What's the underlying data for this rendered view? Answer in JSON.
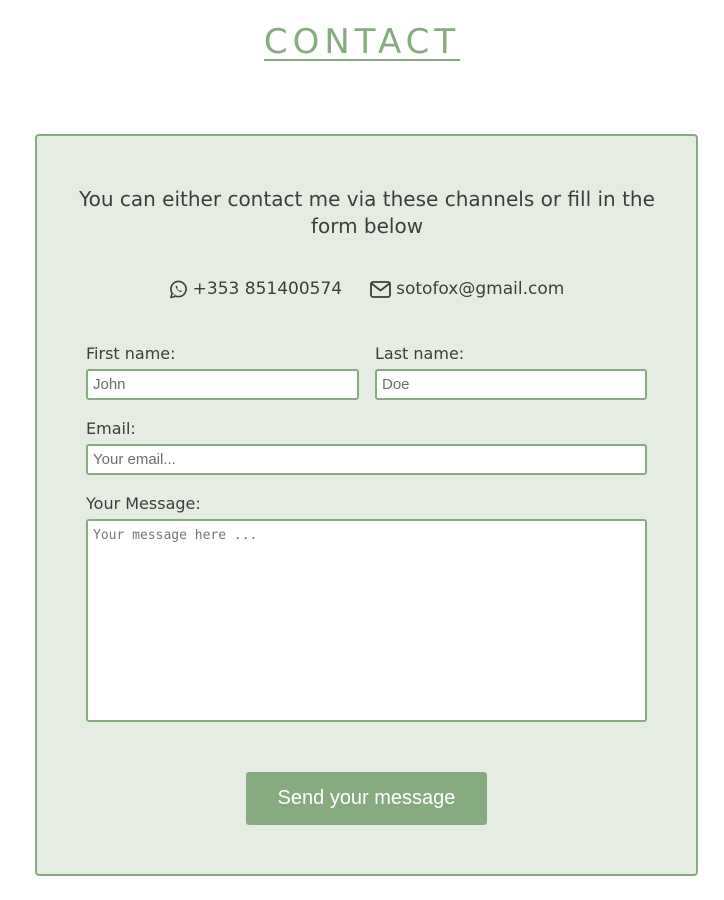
{
  "page": {
    "title": "CONTACT"
  },
  "contact": {
    "intro": "You can either contact me via these channels or fill in the form below",
    "phone": "+353 851400574",
    "phone_icon": "whatsapp-icon",
    "email": "sotofox@gmail.com",
    "email_icon": "envelope-icon"
  },
  "form": {
    "first_name_label": "First name:",
    "first_name_placeholder": "John",
    "last_name_label": "Last name:",
    "last_name_placeholder": "Doe",
    "email_label": "Email:",
    "email_placeholder": "Your email...",
    "message_label": "Your Message:",
    "message_placeholder": "Your message here ...",
    "submit_label": "Send your message"
  },
  "colors": {
    "accent": "#86ab7e",
    "card_background": "#e5ede2",
    "text": "#3d3d3d"
  }
}
